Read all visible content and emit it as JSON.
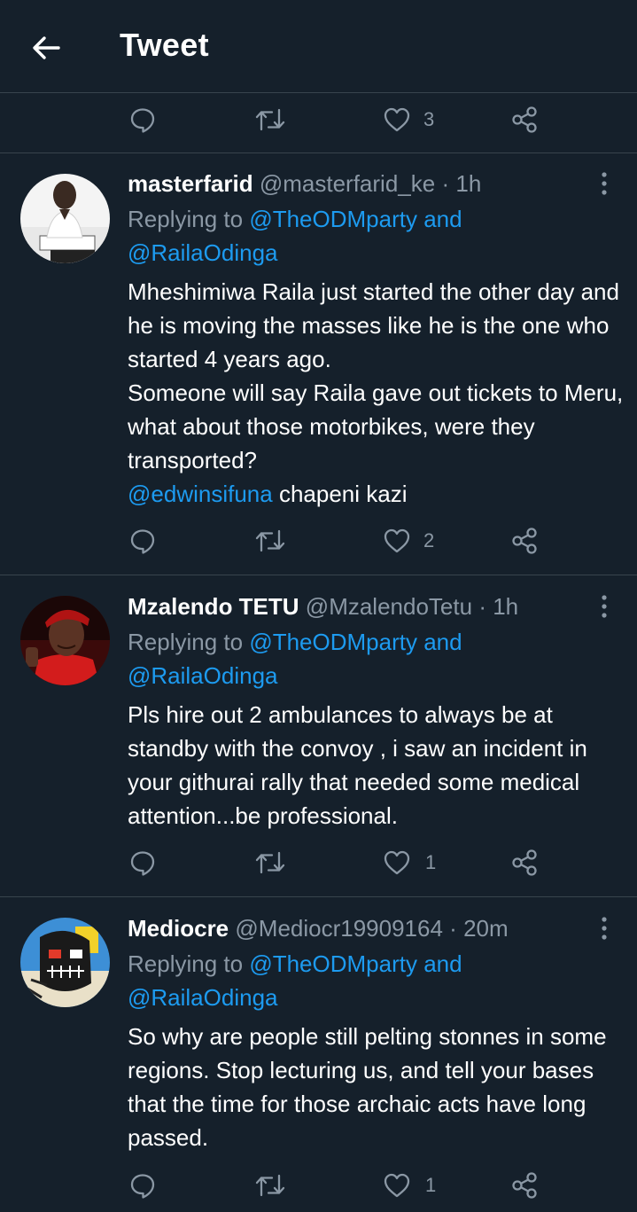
{
  "header": {
    "title": "Tweet",
    "back_icon": "arrow-left-icon"
  },
  "top_actions": {
    "like_count": "3"
  },
  "tweets": [
    {
      "name": "masterfarid",
      "handle": "@masterfarid_ke",
      "dot": "·",
      "time": "1h",
      "replying_label": "Replying to",
      "replying_users": "@TheODMparty and",
      "replying_users2": "@RailaOdinga",
      "lines": [
        "Mheshimiwa Raila just started the other day and he is moving the masses like he is the one who started 4 years ago.",
        "Someone will say Raila gave out tickets to Meru, what about those motorbikes, were they transported?"
      ],
      "mention": "@edwinsifuna",
      "mention_rest": " chapeni kazi",
      "like_count": "2"
    },
    {
      "name": "Mzalendo TETU",
      "handle": "@MzalendoTetu",
      "dot": "·",
      "time": "1h",
      "replying_label": "Replying to",
      "replying_users": "@TheODMparty and",
      "replying_users2": "@RailaOdinga",
      "lines": [
        "Pls hire out 2 ambulances to always be at standby with the convoy , i saw an incident in your githurai rally that needed some medical attention...be professional."
      ],
      "like_count": "1"
    },
    {
      "name": "Mediocre",
      "handle": "@Mediocr19909164",
      "dot": "·",
      "time": "20m",
      "replying_label": "Replying to",
      "replying_users": "@TheODMparty and",
      "replying_users2": "@RailaOdinga",
      "lines": [
        "So why are people still pelting stonnes in some regions. Stop lecturing us, and tell your bases that the time for those archaic acts have long passed."
      ],
      "like_count": "1"
    }
  ],
  "colors": {
    "background": "#15202b",
    "divider": "#38444d",
    "muted": "#8b98a5",
    "link": "#1d9bf0"
  }
}
